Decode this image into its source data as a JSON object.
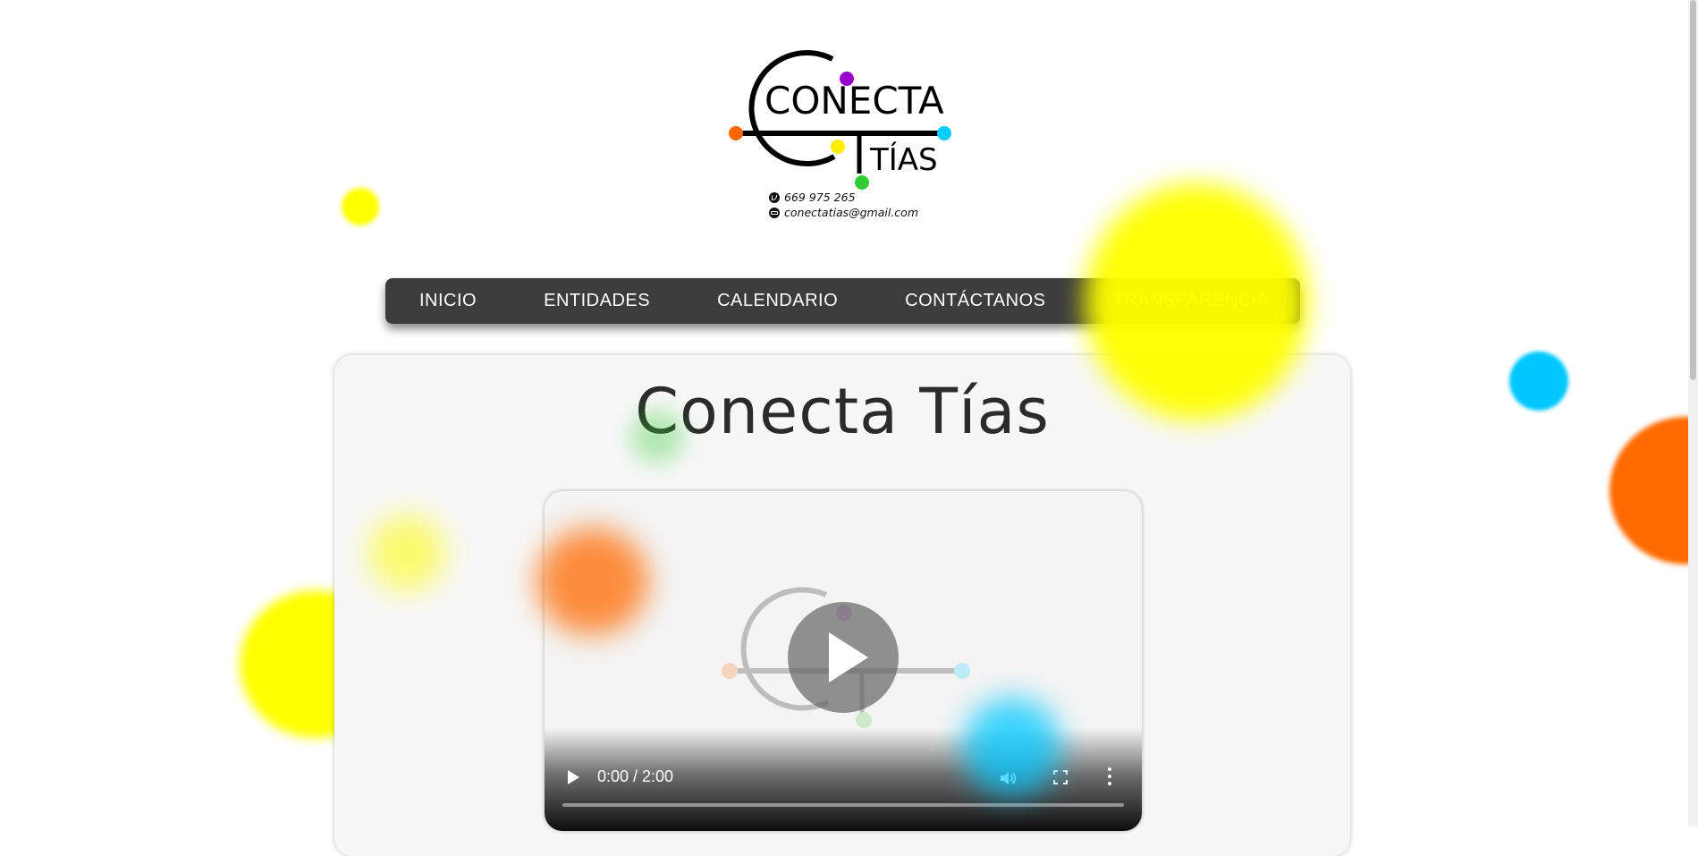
{
  "header": {
    "logo": {
      "line1": "CONECTA",
      "line2": "TÍAS",
      "alt": "Conecta Tías logo"
    },
    "phone_icon": "phone-icon",
    "phone": "669 975 265",
    "email_icon": "mail-icon",
    "email": "conectatias@gmail.com"
  },
  "nav": {
    "items": [
      {
        "label": "INICIO"
      },
      {
        "label": "ENTIDADES"
      },
      {
        "label": "CALENDARIO"
      },
      {
        "label": "CONTÁCTANOS"
      },
      {
        "label": "TRANSPARENCIA"
      }
    ]
  },
  "main": {
    "title": "Conecta Tías",
    "video": {
      "time": "0:00 / 2:00",
      "progress": 0,
      "play_icon": "play-icon",
      "volume_icon": "volume-icon",
      "fullscreen_icon": "fullscreen-icon",
      "more_icon": "more-vertical-icon"
    }
  },
  "colors": {
    "purple": "#9900cc",
    "orange": "#ff6600",
    "yellow": "#ffff00",
    "cyan": "#00ccff",
    "green": "#33cc33",
    "nav_bg": "#3c3c3c",
    "card_bg": "#f7f7f7"
  }
}
